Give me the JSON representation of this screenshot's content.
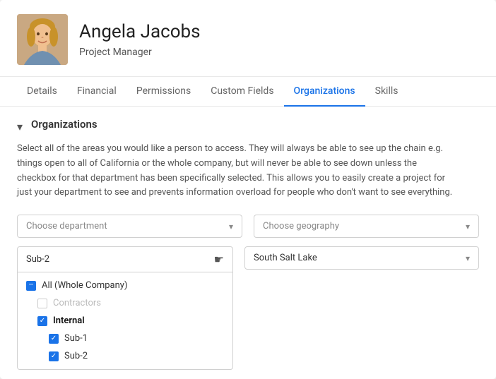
{
  "profile": {
    "name": "Angela Jacobs",
    "title": "Project Manager"
  },
  "tabs": [
    {
      "label": "Details",
      "active": false
    },
    {
      "label": "Financial",
      "active": false
    },
    {
      "label": "Permissions",
      "active": false
    },
    {
      "label": "Custom Fields",
      "active": false
    },
    {
      "label": "Organizations",
      "active": true
    },
    {
      "label": "Skills",
      "active": false
    }
  ],
  "section": {
    "title": "Organizations",
    "description": "Select all of the areas you would like a person to access. They will always be able to see up the chain e.g. things open to all of California or the whole company, but will never be able to see down unless the checkbox for that department has been specifically selected. This allows you to easily create a project for just your department to see and prevents information overload for people who don't want to see everything."
  },
  "dropdowns": {
    "department_placeholder": "Choose department",
    "geography_placeholder": "Choose geography",
    "sub2_value": "Sub-2",
    "south_salt_lake_value": "South Salt Lake"
  },
  "menu_items": [
    {
      "label": "All (Whole Company)",
      "indent": 0,
      "check_state": "partial",
      "bold": false
    },
    {
      "label": "Contractors",
      "indent": 1,
      "check_state": "none",
      "bold": false,
      "disabled": true
    },
    {
      "label": "Internal",
      "indent": 1,
      "check_state": "checked",
      "bold": true
    },
    {
      "label": "Sub-1",
      "indent": 2,
      "check_state": "checked",
      "bold": false
    },
    {
      "label": "Sub-2",
      "indent": 2,
      "check_state": "checked",
      "bold": false
    }
  ],
  "icons": {
    "chevron_down": "▾",
    "toggle_arrow": "▾",
    "cursor": "☛"
  }
}
